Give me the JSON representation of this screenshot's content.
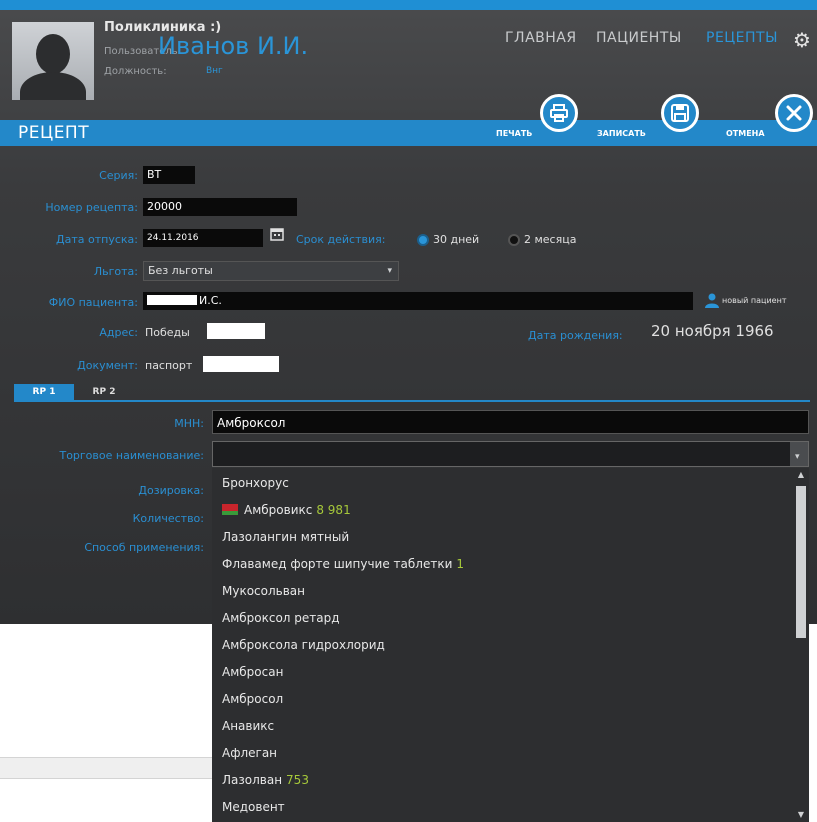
{
  "header": {
    "clinic": "Поликлиника :)",
    "user_label": "Пользователь:",
    "user_name": "Иванов И.И.",
    "position_label": "Должность:",
    "position_value": "Внг"
  },
  "nav": {
    "main": "ГЛАВНАЯ",
    "patients": "ПАЦИЕНТЫ",
    "recipes": "РЕЦЕПТЫ"
  },
  "bar": {
    "title": "РЕЦЕПТ",
    "print": "ПЕЧАТЬ",
    "save": "ЗАПИСАТЬ",
    "cancel": "ОТМЕНА"
  },
  "form": {
    "series_label": "Серия:",
    "series_value": "ВТ",
    "number_label": "Номер рецепта:",
    "number_value": "20000",
    "date_label": "Дата отпуска:",
    "date_value": "24.11.2016",
    "validity_label": "Срок действия:",
    "validity_30": "30 дней",
    "validity_2m": "2 месяца",
    "benefit_label": "Льгота:",
    "benefit_value": "Без льготы",
    "patient_label": "ФИО пациента:",
    "patient_value": "И.С.",
    "new_patient": "новый пациент",
    "address_label": "Адрес:",
    "address_value": "Победы",
    "birth_label": "Дата рождения:",
    "birth_value": "20 ноября 1966",
    "doc_label": "Документ:",
    "doc_value": "паспорт"
  },
  "tabs": [
    "RP 1",
    "RP 2"
  ],
  "rp": {
    "mnn_label": "МНН:",
    "mnn_value": "Амброксол",
    "trade_label": "Торговое наименование:",
    "dose_label": "Дозировка:",
    "qty_label": "Количество:",
    "method_label": "Способ применения:"
  },
  "options": [
    {
      "name": "Бронхорус",
      "qty": ""
    },
    {
      "name": "Амбровикс",
      "qty": "8 981"
    },
    {
      "name": "Лазолангин мятный",
      "qty": ""
    },
    {
      "name": "Флавамед форте шипучие таблетки",
      "qty": "1"
    },
    {
      "name": "Мукосольван",
      "qty": ""
    },
    {
      "name": "Амброксол ретард",
      "qty": ""
    },
    {
      "name": "Амброксола гидрохлорид",
      "qty": ""
    },
    {
      "name": "Амбросан",
      "qty": ""
    },
    {
      "name": "Амбросол",
      "qty": ""
    },
    {
      "name": "Анавикс",
      "qty": ""
    },
    {
      "name": "Афлеган",
      "qty": ""
    },
    {
      "name": "Лазолван",
      "qty": "753"
    },
    {
      "name": "Медовент",
      "qty": ""
    }
  ],
  "colors": {
    "accent": "#2388c9",
    "link": "#2a95d8",
    "qty": "#a6c83a"
  }
}
